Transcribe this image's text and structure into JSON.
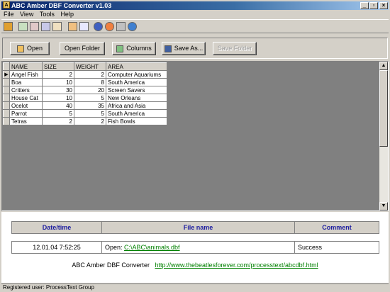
{
  "window": {
    "title": "ABC Amber DBF Converter v1.03",
    "min": "_",
    "max": "▫",
    "close": "×"
  },
  "menu": [
    "File",
    "View",
    "Tools",
    "Help"
  ],
  "buttons": {
    "open": "Open",
    "open_folder": "Open Folder",
    "columns": "Columns",
    "save_as": "Save As...",
    "save_folder": "Save Folder"
  },
  "grid": {
    "columns": [
      "NAME",
      "SIZE",
      "WEIGHT",
      "AREA"
    ],
    "rows": [
      [
        "Angel Fish",
        "2",
        "2",
        "Computer Aquariums"
      ],
      [
        "Boa",
        "10",
        "8",
        "South America"
      ],
      [
        "Critters",
        "30",
        "20",
        "Screen Savers"
      ],
      [
        "House Cat",
        "10",
        "5",
        "New Orleans"
      ],
      [
        "Ocelot",
        "40",
        "35",
        "Africa and Asia"
      ],
      [
        "Parrot",
        "5",
        "5",
        "South America"
      ],
      [
        "Tetras",
        "2",
        "2",
        "Fish Bowls"
      ]
    ]
  },
  "log": {
    "headers": [
      "Date/time",
      "File name",
      "Comment"
    ],
    "row": {
      "datetime": "12.01.04 7:52:25",
      "prefix": "Open: ",
      "file": "C:\\ABC\\animals.dbf",
      "comment": "Success"
    }
  },
  "footer": {
    "text": "ABC Amber DBF Converter",
    "url": "http://www.thebeatlesforever.com/processtext/abcdbf.html"
  },
  "status": "Registered user: ProcessText Group",
  "colors": {
    "title_start": "#0a246a",
    "title_end": "#a6caf0",
    "log_header": "#2020a0",
    "link": "#008000"
  }
}
